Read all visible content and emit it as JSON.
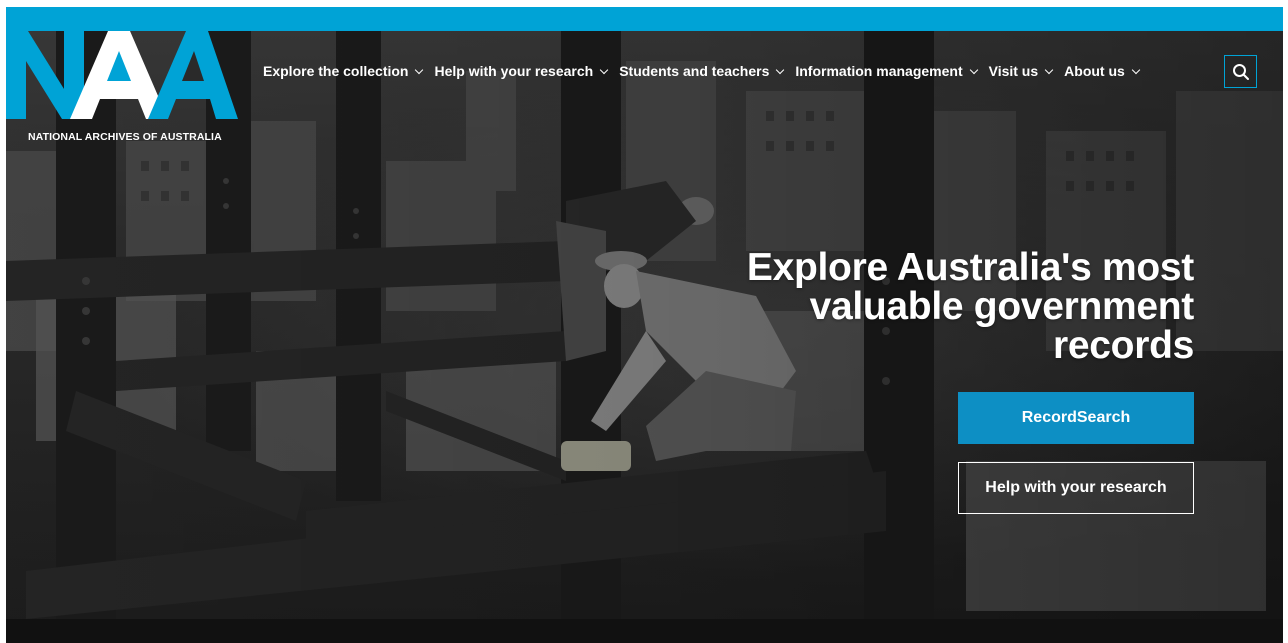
{
  "brand": {
    "logo_letters": "NAA",
    "name": "NATIONAL ARCHIVES OF AUSTRALIA",
    "accent_color": "#00a3d6"
  },
  "nav": {
    "items": [
      {
        "label": "Explore the collection"
      },
      {
        "label": "Help with your research"
      },
      {
        "label": "Students and teachers"
      },
      {
        "label": "Information management"
      },
      {
        "label": "Visit us"
      },
      {
        "label": "About us"
      }
    ],
    "search_icon": "search-icon"
  },
  "hero": {
    "headline": "Explore Australia's most valuable government records",
    "primary_button": "RecordSearch",
    "secondary_button": "Help with your research",
    "primary_color": "#0d8fc4"
  }
}
